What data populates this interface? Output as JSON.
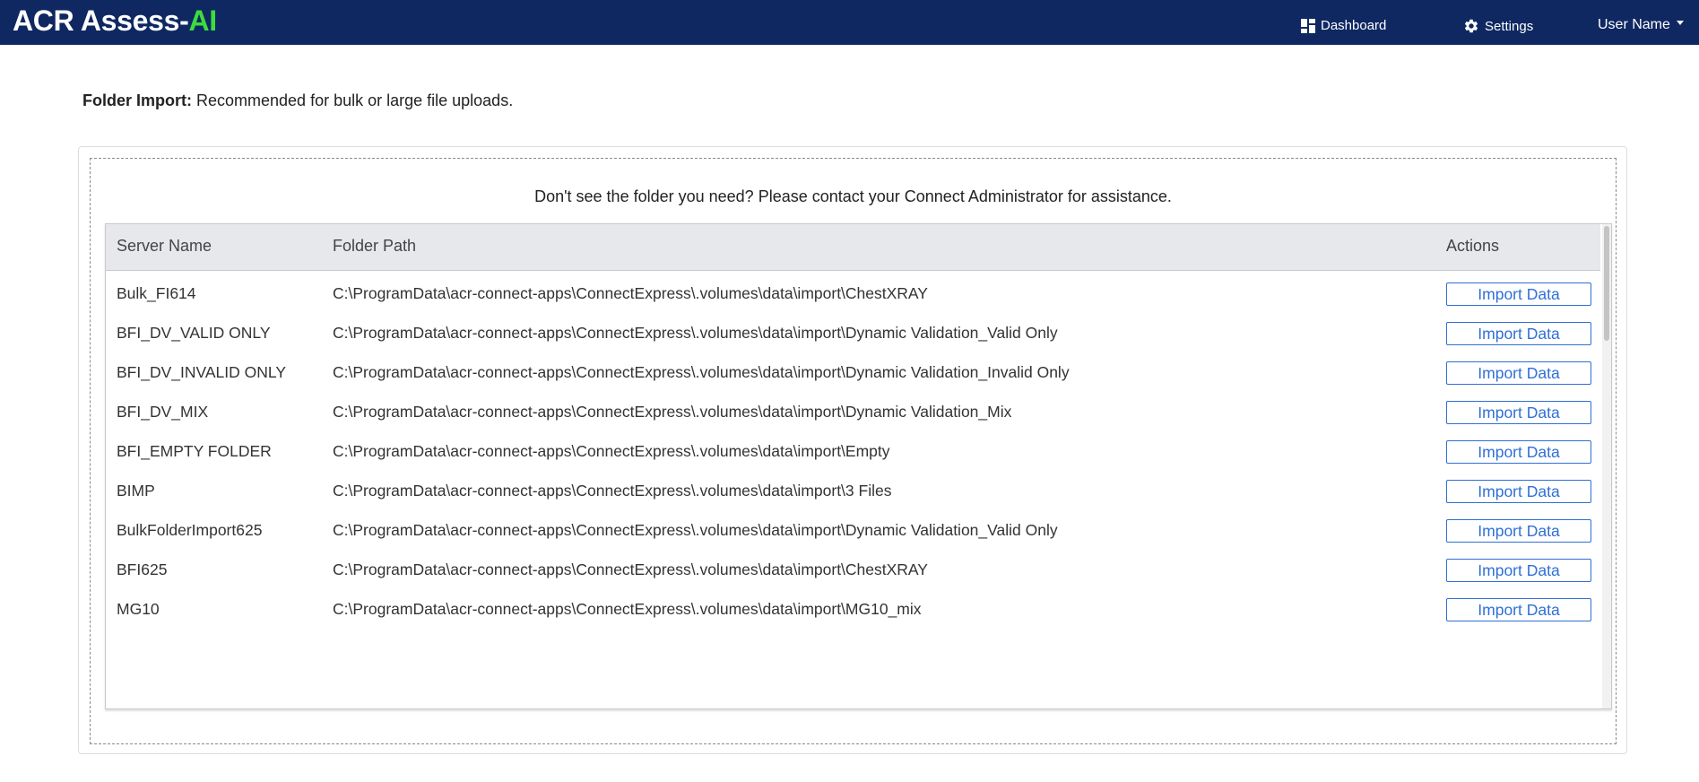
{
  "brand": {
    "main": "ACR Assess-",
    "accent": "AI"
  },
  "nav": {
    "dashboard": "Dashboard",
    "settings": "Settings",
    "user": "User Name"
  },
  "intro": {
    "label": "Folder Import:",
    "text": " Recommended for bulk or large file uploads."
  },
  "notice": "Don't see the folder you need? Please contact your Connect Administrator for assistance.",
  "table": {
    "headers": {
      "server": "Server Name",
      "path": "Folder Path",
      "actions": "Actions"
    },
    "rows": [
      {
        "server": "Bulk_FI614",
        "path": "C:\\ProgramData\\acr-connect-apps\\ConnectExpress\\.volumes\\data\\import\\ChestXRAY",
        "action": "Import Data"
      },
      {
        "server": "BFI_DV_VALID ONLY",
        "path": "C:\\ProgramData\\acr-connect-apps\\ConnectExpress\\.volumes\\data\\import\\Dynamic Validation_Valid Only",
        "action": "Import Data"
      },
      {
        "server": "BFI_DV_INVALID ONLY",
        "path": "C:\\ProgramData\\acr-connect-apps\\ConnectExpress\\.volumes\\data\\import\\Dynamic Validation_Invalid Only",
        "action": "Import Data"
      },
      {
        "server": "BFI_DV_MIX",
        "path": "C:\\ProgramData\\acr-connect-apps\\ConnectExpress\\.volumes\\data\\import\\Dynamic Validation_Mix",
        "action": "Import Data"
      },
      {
        "server": "BFI_EMPTY FOLDER",
        "path": "C:\\ProgramData\\acr-connect-apps\\ConnectExpress\\.volumes\\data\\import\\Empty",
        "action": "Import Data"
      },
      {
        "server": "BIMP",
        "path": "C:\\ProgramData\\acr-connect-apps\\ConnectExpress\\.volumes\\data\\import\\3 Files",
        "action": "Import Data"
      },
      {
        "server": "BulkFolderImport625",
        "path": "C:\\ProgramData\\acr-connect-apps\\ConnectExpress\\.volumes\\data\\import\\Dynamic Validation_Valid Only",
        "action": "Import Data"
      },
      {
        "server": "BFI625",
        "path": "C:\\ProgramData\\acr-connect-apps\\ConnectExpress\\.volumes\\data\\import\\ChestXRAY",
        "action": "Import Data"
      },
      {
        "server": "MG10",
        "path": "C:\\ProgramData\\acr-connect-apps\\ConnectExpress\\.volumes\\data\\import\\MG10_mix",
        "action": "Import Data"
      }
    ]
  },
  "colors": {
    "navbar": "#0f2862",
    "brand_accent": "#3ddc3d",
    "button": "#2f6fd6",
    "table_header": "#e6e8eb"
  },
  "icons": {
    "dashboard": "dashboard-icon",
    "settings": "gear-icon",
    "user_menu": "caret-down-icon"
  }
}
